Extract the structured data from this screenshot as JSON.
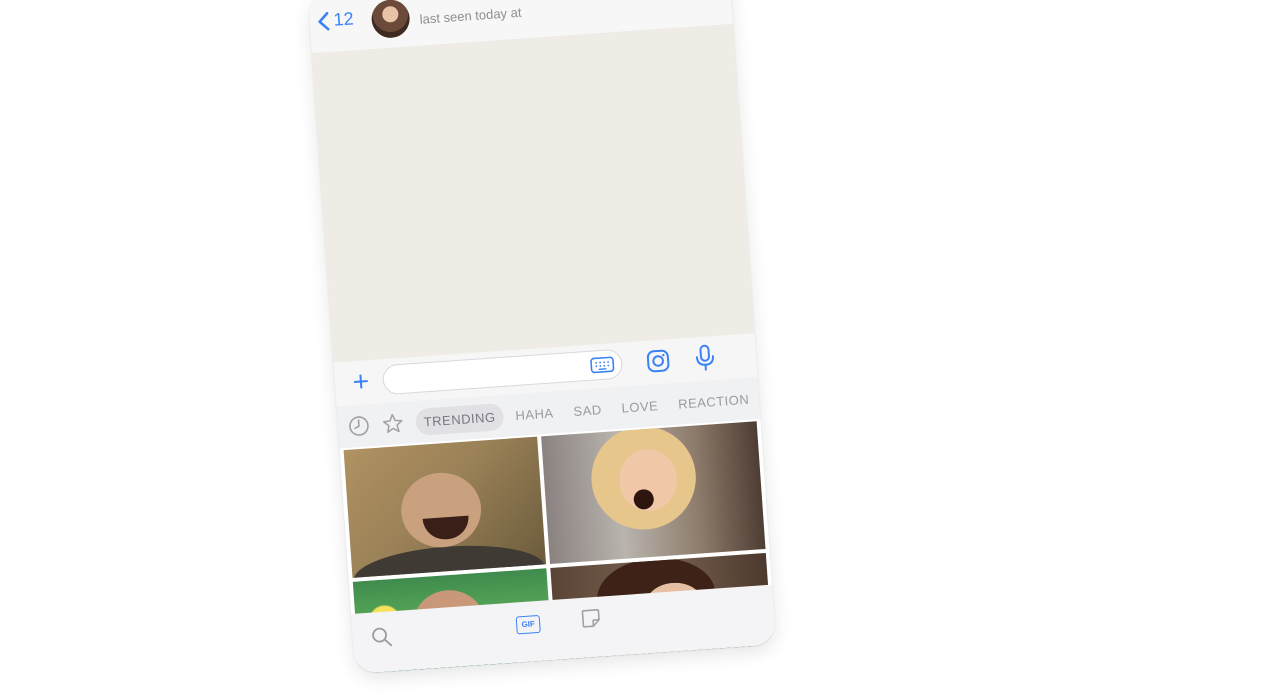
{
  "header": {
    "back_count": "12",
    "status": "last seen today at"
  },
  "input": {
    "placeholder": "",
    "value": ""
  },
  "tabs": [
    {
      "label": "TRENDING",
      "active": true
    },
    {
      "label": "HAHA",
      "active": false
    },
    {
      "label": "SAD",
      "active": false
    },
    {
      "label": "LOVE",
      "active": false
    },
    {
      "label": "REACTION",
      "active": false
    }
  ],
  "icons": {
    "back": "chevron-left-icon",
    "camera": "camera-icon",
    "mic": "microphone-icon",
    "keyboard": "keyboard-icon",
    "recent": "clock-icon",
    "favorites": "star-icon",
    "search": "search-icon",
    "sticker": "sticker-icon"
  },
  "bottombar": {
    "gif_label": "GIF"
  },
  "colors": {
    "accent": "#3b82f6",
    "chat_background": "#efebe5",
    "tab_active_background": "#e1e1e5"
  }
}
